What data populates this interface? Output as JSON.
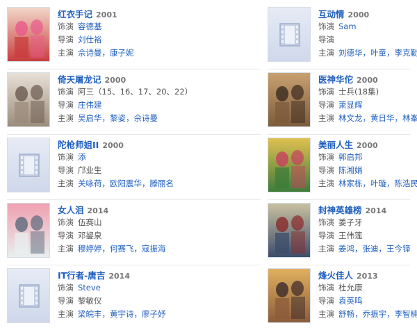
{
  "shows": [
    {
      "title": "红衣手记",
      "year": "2001",
      "director_label": "饰演",
      "director": "容德基",
      "writer_label": "导演",
      "writer": "刘仕裕",
      "cast_label": "主演",
      "cast": [
        "佘诗曼",
        "康子妮"
      ],
      "poster": "photo"
    },
    {
      "title": "互动情",
      "year": "2000",
      "director_label": "饰演",
      "director": "Sam",
      "writer_label": "导演",
      "writer": "",
      "cast_label": "主演",
      "cast": [
        "刘德华",
        "叶童",
        "李克勤"
      ],
      "poster": "placeholder"
    },
    {
      "title": "倚天屠龙记",
      "year": "2000",
      "director_label": "饰演",
      "director": "阿三（15、16、17、20、22）",
      "writer_label": "导演",
      "writer": "庄伟建",
      "cast_label": "主演",
      "cast": [
        "吴启华",
        "黎姿",
        "佘诗曼"
      ],
      "poster": "photo"
    },
    {
      "title": "医神华佗",
      "year": "2000",
      "director_label": "饰演",
      "director": "士兵(18集)",
      "writer_label": "导演",
      "writer": "萧显辉",
      "cast_label": "主演",
      "cast": [
        "林文龙",
        "黄日华",
        "林峯"
      ],
      "poster": "photo"
    },
    {
      "title": "陀枪师姐II",
      "year": "2000",
      "director_label": "饰演",
      "director": "添",
      "writer_label": "导演",
      "writer": "邝业生",
      "cast_label": "主演",
      "cast": [
        "关咏荷",
        "欧阳震华",
        "滕丽名"
      ],
      "poster": "placeholder"
    },
    {
      "title": "美丽人生",
      "year": "2000",
      "director_label": "饰演",
      "director": "郭启邦",
      "writer_label": "导演",
      "writer": "陈湘娟",
      "cast_label": "主演",
      "cast": [
        "林家栋",
        "叶璇",
        "陈浩民"
      ],
      "poster": "photo"
    },
    {
      "title": "女人泪",
      "year": "2014",
      "director_label": "饰演",
      "director": "伍赛山",
      "writer_label": "导演",
      "writer": "邓鋆泉",
      "cast_label": "主演",
      "cast": [
        "穆婷婷",
        "何赛飞",
        "寇振海"
      ],
      "poster": "photo"
    },
    {
      "title": "封神英雄榜",
      "year": "2014",
      "director_label": "饰演",
      "director": "姜子牙",
      "writer_label": "导演",
      "writer": "王伟莲",
      "cast_label": "主演",
      "cast": [
        "姜鸿",
        "张迪",
        "王今铎"
      ],
      "poster": "photo"
    },
    {
      "title": "IT行者-唐吉",
      "year": "2014",
      "director_label": "饰演",
      "director": "Steve",
      "writer_label": "导演",
      "writer": "黎敏仪",
      "cast_label": "主演",
      "cast": [
        "梁皖丰",
        "黄宇诗",
        "廖子妤"
      ],
      "poster": "placeholder"
    },
    {
      "title": "烽火佳人",
      "year": "2013",
      "director_label": "饰演",
      "director": "杜允康",
      "writer_label": "导演",
      "writer": "袁英鸣",
      "cast_label": "主演",
      "cast": [
        "舒畅",
        "乔振宇",
        "李智楠"
      ],
      "poster": "photo"
    }
  ],
  "show_extra": {
    "1": {
      "writer": "刘德华, 叶童, 李克勤"
    }
  },
  "credits_fix": [
    {
      "role": "饰演 容德基 / 导演 刘仕裕 / 主演 佘诗曼, 康子妮"
    },
    {
      "role": "饰演 Sam / 导演 — / 主演 刘德华, 叶童, 李克勤"
    },
    {
      "role": "饰演 阿三（15、16、17、20、22） / 导演 庄伟建 / 主演 吴启华, 黎姿, 佘诗曼"
    },
    {
      "role": "饰演 士兵(18集) / 导演 萧显辉 / 主演 林文龙, 黄日华, 林峯"
    },
    {
      "role": "饰演 添 / 导演 邝业生 / 主演 关咏荷, 欧阳震华, 滕丽名"
    },
    {
      "role": "饰演 郭启邦 / 导演 陈湘娟 / 主演 林家栋, 叶璇, 陈浩民"
    },
    {
      "role": "饰演 伍赛山 / 导演 邓鋆泉 / 主演 穆婷婷, 何赛飞, 寇振海"
    },
    {
      "role": "饰演 姜子牙 / 导演 王伟莲 / 主演 姜鸿, 张迪, 王今铎"
    },
    {
      "role": "饰演 Steve / 导演 黎敏仪 / 主演 梁皖丰, 黄宇诗, 廖子妤"
    },
    {
      "role": "饰演 杜允康 / 导演 袁英鸣 / 主演 舒畅, 乔振宇, 李智楠"
    }
  ],
  "colors": {
    "link": "#1f5fbf",
    "placeholder_bg": "#dde3ef"
  }
}
